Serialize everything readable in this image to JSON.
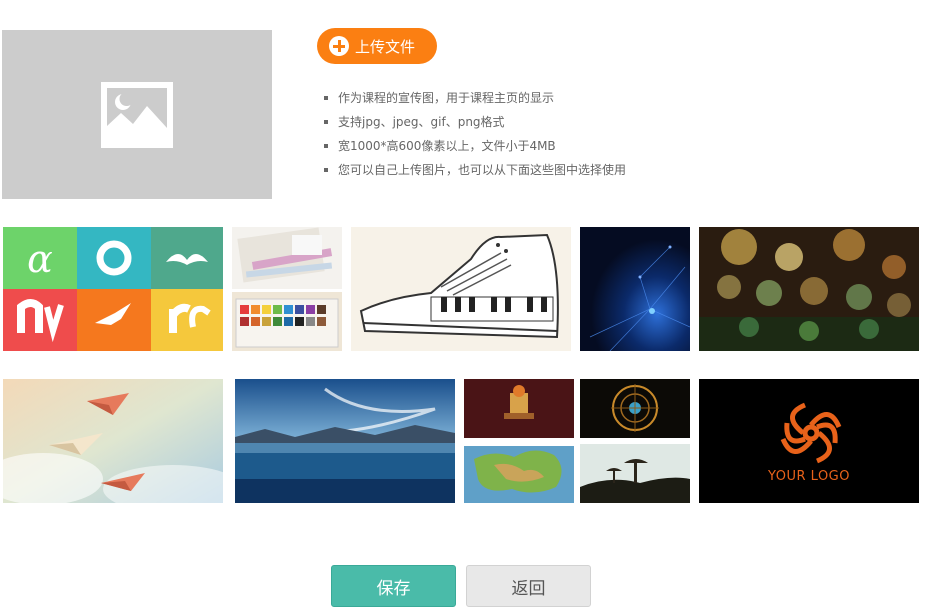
{
  "upload": {
    "label": "上传文件"
  },
  "notes": [
    "作为课程的宣传图，用于课程主页的显示",
    "支持jpg、jpeg、gif、png格式",
    "宽1000*高600像素以上，文件小于4MB",
    "您可以自己上传图片，也可以从下面这些图中选择使用"
  ],
  "gallery": {
    "logo_text": "YOUR LOGO"
  },
  "actions": {
    "save_label": "保存",
    "back_label": "返回"
  },
  "colors": {
    "accent_orange": "#fb7f12",
    "save_teal": "#4abba9",
    "placeholder_gray": "#cccccc"
  }
}
